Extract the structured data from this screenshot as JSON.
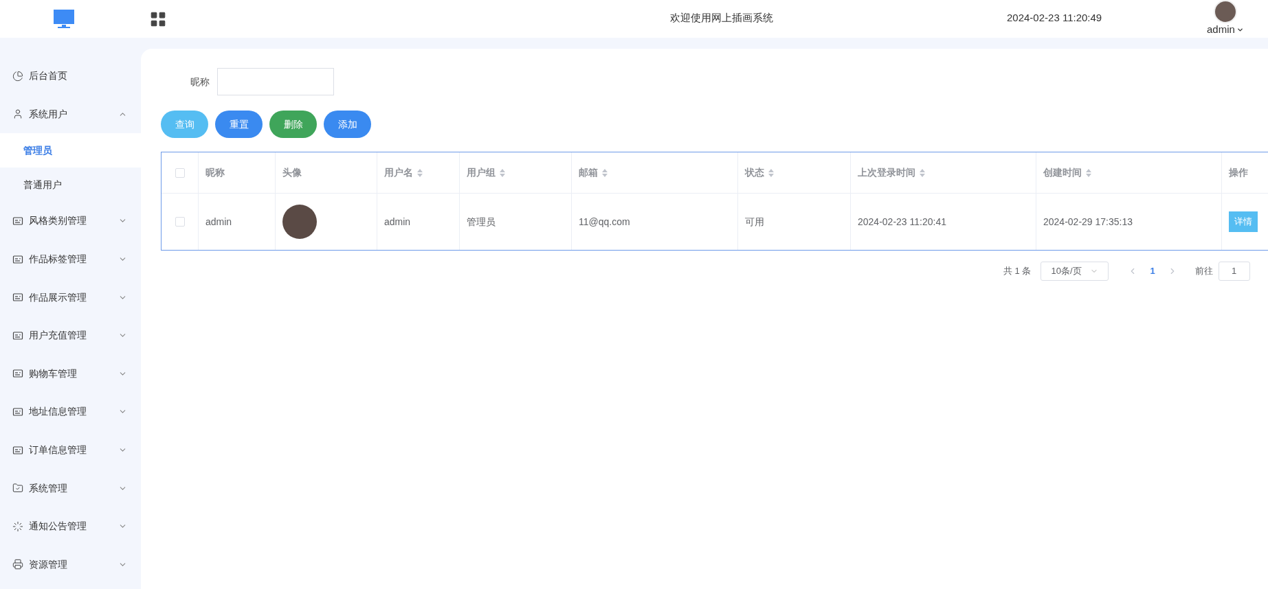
{
  "header": {
    "title": "欢迎使用网上插画系统",
    "datetime": "2024-02-23 11:20:49",
    "user": "admin"
  },
  "sidebar": {
    "items": [
      {
        "label": "后台首页",
        "kind": "chart",
        "selected": false
      },
      {
        "label": "系统用户",
        "kind": "user",
        "expanded": true,
        "selected": false,
        "children": [
          {
            "label": "管理员",
            "selected": true
          },
          {
            "label": "普通用户",
            "selected": false
          }
        ]
      },
      {
        "label": "风格类别管理",
        "kind": "card",
        "expanded": false,
        "selected": false
      },
      {
        "label": "作品标签管理",
        "kind": "card",
        "expanded": false,
        "selected": false
      },
      {
        "label": "作品展示管理",
        "kind": "card",
        "expanded": false,
        "selected": false
      },
      {
        "label": "用户充值管理",
        "kind": "card",
        "expanded": false,
        "selected": false
      },
      {
        "label": "购物车管理",
        "kind": "card",
        "expanded": false,
        "selected": false
      },
      {
        "label": "地址信息管理",
        "kind": "card",
        "expanded": false,
        "selected": false
      },
      {
        "label": "订单信息管理",
        "kind": "card",
        "expanded": false,
        "selected": false
      },
      {
        "label": "系统管理",
        "kind": "folder",
        "expanded": false,
        "selected": false
      },
      {
        "label": "通知公告管理",
        "kind": "loader",
        "expanded": false,
        "selected": false
      },
      {
        "label": "资源管理",
        "kind": "printer",
        "expanded": false,
        "selected": false
      }
    ]
  },
  "search": {
    "label": "昵称"
  },
  "buttons": [
    {
      "label": "查询",
      "color": "#55bdf2"
    },
    {
      "label": "重置",
      "color": "#3a8af0"
    },
    {
      "label": "删除",
      "color": "#3fa55a"
    },
    {
      "label": "添加",
      "color": "#3a8af0"
    }
  ],
  "table": {
    "columns": [
      {
        "label": "昵称",
        "sortable": false
      },
      {
        "label": "头像",
        "sortable": false
      },
      {
        "label": "用户名",
        "sortable": true
      },
      {
        "label": "用户组",
        "sortable": true
      },
      {
        "label": "邮箱",
        "sortable": true
      },
      {
        "label": "状态",
        "sortable": true
      },
      {
        "label": "上次登录时间",
        "sortable": true
      },
      {
        "label": "创建时间",
        "sortable": true
      },
      {
        "label": "操作",
        "sortable": false
      }
    ],
    "header_checked": false,
    "rows": [
      {
        "checked": false,
        "nickname": "admin",
        "username": "admin",
        "group": "管理员",
        "email": "11@qq.com",
        "status": "可用",
        "last_login": "2024-02-23 11:20:41",
        "created": "2024-02-29 17:35:13",
        "action": "详情"
      }
    ]
  },
  "pagination": {
    "total": "共 1 条",
    "page_size": "10条/页",
    "pages": [
      {
        "label": "1",
        "selected": true
      }
    ],
    "goto_label": "前往",
    "goto_value": "1"
  }
}
